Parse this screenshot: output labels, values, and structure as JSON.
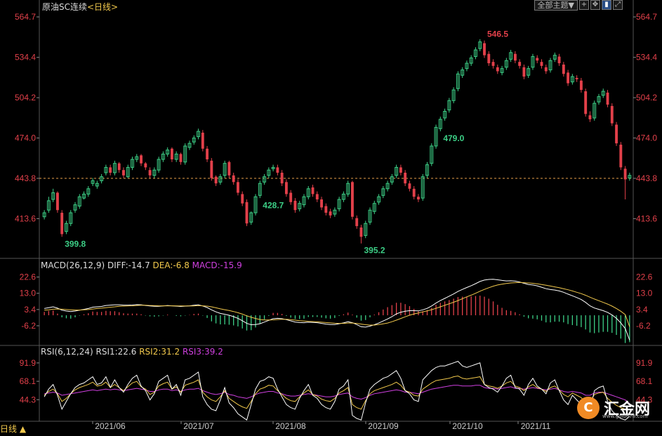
{
  "header": {
    "instrument": "原油SC连续",
    "period_tag": "<日线>",
    "range_button": "全部主题▼",
    "toolbar_icons": [
      "crosshair-icon",
      "move-icon",
      "chart-type-icon",
      "zoom-icon"
    ]
  },
  "macd": {
    "label": "MACD(26,12,9)",
    "diff": "DIFF:-14.7",
    "dea": "DEA:-6.8",
    "macd": "MACD:-15.9"
  },
  "rsi": {
    "label": "RSI(6,12,24)",
    "rsi1": "RSI1:22.6",
    "rsi2": "RSI2:31.2",
    "rsi3": "RSI3:39.2"
  },
  "footer": {
    "period_label": "日线 ▲"
  },
  "logo": {
    "text": "汇金网",
    "url": "www.gold678.com"
  },
  "colors": {
    "up": "#3ccf86",
    "down": "#e2404a",
    "axis_text": "#e2404a",
    "dashed_line": "#e8a04a",
    "macd_dea": "#f2c94c",
    "rsi3": "#d040e0"
  },
  "chart_data": {
    "type": "candlestick",
    "price_ticks": [
      564.7,
      534.4,
      504.2,
      474.0,
      443.8,
      413.6
    ],
    "price_ylim": [
      387,
      570
    ],
    "last_price_line": 443.8,
    "annotations": [
      {
        "label": "399.8",
        "value": 399.8
      },
      {
        "label": "479.0",
        "value": 479.0
      },
      {
        "label": "395.2",
        "value": 395.2
      },
      {
        "label": "546.5",
        "value": 546.5
      },
      {
        "label": "428.7",
        "value": 428.7
      }
    ],
    "x_labels": [
      "2021/06",
      "2021/07",
      "2021/08",
      "2021/09",
      "2021/10",
      "2021/11"
    ],
    "closes": [
      418,
      427,
      433,
      420,
      402,
      410,
      418,
      424,
      430,
      432,
      436,
      442,
      440,
      445,
      452,
      448,
      455,
      450,
      446,
      452,
      458,
      460,
      455,
      452,
      446,
      450,
      458,
      462,
      465,
      458,
      462,
      456,
      468,
      470,
      474,
      479,
      466,
      458,
      444,
      440,
      445,
      455,
      446,
      441,
      433,
      425,
      410,
      418,
      430,
      440,
      445,
      450,
      452,
      448,
      440,
      432,
      426,
      420,
      425,
      430,
      436,
      432,
      428,
      422,
      418,
      416,
      420,
      428,
      432,
      440,
      415,
      408,
      400,
      410,
      420,
      425,
      430,
      436,
      440,
      445,
      452,
      448,
      440,
      436,
      430,
      428,
      445,
      454,
      468,
      482,
      488,
      494,
      502,
      510,
      522,
      525,
      530,
      534,
      540,
      546,
      536,
      530,
      528,
      524,
      526,
      532,
      538,
      532,
      528,
      520,
      526,
      535,
      532,
      528,
      524,
      532,
      536,
      530,
      522,
      515,
      520,
      518,
      510,
      492,
      488,
      500,
      505,
      509,
      499,
      485,
      470,
      452,
      443,
      446
    ],
    "opens": [
      415,
      420,
      428,
      433,
      418,
      404,
      410,
      420,
      423,
      429,
      432,
      440,
      438,
      442,
      448,
      452,
      448,
      455,
      450,
      445,
      452,
      458,
      461,
      455,
      450,
      446,
      450,
      458,
      462,
      466,
      458,
      462,
      456,
      467,
      471,
      475,
      478,
      466,
      457,
      445,
      441,
      446,
      456,
      446,
      441,
      432,
      426,
      411,
      418,
      431,
      441,
      446,
      451,
      452,
      448,
      441,
      433,
      427,
      421,
      424,
      430,
      437,
      432,
      428,
      423,
      419,
      417,
      421,
      428,
      432,
      441,
      414,
      407,
      401,
      411,
      419,
      426,
      431,
      436,
      441,
      446,
      452,
      448,
      440,
      436,
      430,
      429,
      446,
      455,
      468,
      481,
      489,
      495,
      502,
      511,
      521,
      526,
      530,
      535,
      541,
      545,
      537,
      531,
      527,
      523,
      527,
      533,
      537,
      531,
      527,
      521,
      527,
      534,
      531,
      527,
      525,
      533,
      535,
      529,
      523,
      516,
      519,
      517,
      509,
      491,
      489,
      501,
      506,
      508,
      498,
      484,
      469,
      451,
      444
    ],
    "highs": [
      420,
      430,
      436,
      434,
      420,
      412,
      420,
      426,
      432,
      434,
      438,
      444,
      442,
      447,
      454,
      454,
      457,
      456,
      452,
      454,
      460,
      462,
      462,
      456,
      452,
      452,
      460,
      464,
      467,
      467,
      464,
      463,
      470,
      472,
      476,
      481,
      480,
      468,
      459,
      446,
      447,
      457,
      457,
      448,
      443,
      434,
      428,
      419,
      432,
      442,
      447,
      452,
      454,
      454,
      450,
      443,
      435,
      429,
      427,
      432,
      438,
      439,
      434,
      430,
      425,
      421,
      422,
      430,
      434,
      442,
      442,
      416,
      409,
      412,
      422,
      427,
      432,
      438,
      442,
      447,
      454,
      454,
      450,
      442,
      438,
      432,
      447,
      456,
      470,
      484,
      490,
      496,
      504,
      512,
      524,
      527,
      532,
      536,
      542,
      548,
      547,
      539,
      533,
      529,
      528,
      534,
      540,
      539,
      533,
      529,
      528,
      537,
      536,
      533,
      529,
      534,
      538,
      537,
      531,
      525,
      522,
      521,
      519,
      511,
      494,
      502,
      507,
      511,
      510,
      500,
      486,
      471,
      453,
      448
    ],
    "lows": [
      413,
      418,
      426,
      418,
      400,
      402,
      408,
      418,
      421,
      428,
      430,
      438,
      436,
      440,
      446,
      446,
      446,
      448,
      444,
      444,
      450,
      456,
      453,
      450,
      444,
      444,
      448,
      456,
      460,
      456,
      456,
      454,
      454,
      465,
      469,
      473,
      464,
      456,
      442,
      438,
      439,
      444,
      444,
      439,
      431,
      423,
      408,
      409,
      416,
      429,
      439,
      444,
      449,
      446,
      438,
      430,
      424,
      418,
      419,
      422,
      428,
      430,
      426,
      420,
      416,
      414,
      415,
      419,
      426,
      430,
      413,
      406,
      395,
      399,
      409,
      417,
      424,
      429,
      434,
      439,
      444,
      446,
      438,
      434,
      428,
      426,
      427,
      444,
      453,
      466,
      479,
      487,
      493,
      500,
      509,
      519,
      524,
      528,
      533,
      539,
      534,
      528,
      526,
      522,
      521,
      525,
      531,
      530,
      526,
      518,
      519,
      525,
      530,
      526,
      522,
      523,
      531,
      528,
      520,
      513,
      514,
      516,
      508,
      490,
      486,
      487,
      499,
      504,
      497,
      483,
      468,
      450,
      428,
      442
    ],
    "macd_ticks": [
      22.6,
      13.0,
      3.4,
      -6.2
    ],
    "macd_ylim": [
      -17,
      27
    ],
    "diff": [
      4,
      4.5,
      5,
      4.2,
      3,
      2.5,
      2.2,
      2.5,
      3,
      3.5,
      4,
      4.8,
      5,
      5.2,
      5.8,
      6,
      6.2,
      6.2,
      6,
      6,
      6.1,
      6.3,
      6.2,
      5.8,
      5.5,
      5.3,
      5.3,
      5.5,
      5.8,
      5.6,
      5.4,
      5.2,
      5.4,
      5.6,
      5.9,
      6.2,
      5.5,
      4.6,
      3.2,
      2,
      1.1,
      0.6,
      0,
      -0.8,
      -1.8,
      -3.2,
      -4.8,
      -5.6,
      -5.5,
      -5,
      -4,
      -3,
      -2,
      -1.8,
      -2,
      -2.6,
      -3.3,
      -4,
      -4.3,
      -4.4,
      -4.1,
      -4.2,
      -4.4,
      -4.8,
      -5.2,
      -5.5,
      -5.5,
      -5,
      -4.5,
      -3.8,
      -4.4,
      -5.5,
      -6.8,
      -7,
      -6.4,
      -5.6,
      -4.6,
      -3.4,
      -2.2,
      -0.8,
      0.8,
      1.8,
      2.4,
      2.7,
      2.7,
      2.6,
      3.2,
      4.1,
      5.5,
      7.2,
      8.7,
      10,
      11.3,
      12.6,
      14.1,
      15.3,
      16.4,
      17.5,
      18.7,
      20,
      20.8,
      21.2,
      21.3,
      21,
      20.6,
      20.3,
      20.4,
      20.2,
      19.7,
      18.9,
      18.2,
      17.9,
      17.4,
      16.6,
      15.7,
      15.2,
      14.9,
      14.4,
      13.6,
      12.5,
      11.5,
      10.5,
      9.3,
      7.6,
      5.6,
      4.3,
      3.5,
      2.7,
      1.7,
      0.2,
      -1.8,
      -4.5,
      -7.8,
      -14.7
    ],
    "dea": [
      3,
      3.2,
      3.6,
      3.7,
      3.6,
      3.4,
      3.2,
      3.1,
      3.1,
      3.2,
      3.4,
      3.7,
      4,
      4.2,
      4.5,
      4.8,
      5,
      5.3,
      5.4,
      5.5,
      5.6,
      5.8,
      5.9,
      5.9,
      5.8,
      5.7,
      5.6,
      5.6,
      5.6,
      5.6,
      5.6,
      5.5,
      5.5,
      5.5,
      5.5,
      5.7,
      5.6,
      5.4,
      5,
      4.4,
      3.8,
      3.3,
      2.8,
      2.2,
      1.5,
      0.7,
      -0.3,
      -1.2,
      -1.9,
      -2.5,
      -2.8,
      -2.8,
      -2.7,
      -2.5,
      -2.4,
      -2.4,
      -2.6,
      -2.9,
      -3.2,
      -3.4,
      -3.6,
      -3.7,
      -3.9,
      -4.1,
      -4.3,
      -4.5,
      -4.7,
      -4.8,
      -4.8,
      -4.6,
      -4.6,
      -4.8,
      -5.2,
      -5.6,
      -5.8,
      -5.8,
      -5.5,
      -5.1,
      -4.6,
      -3.8,
      -2.9,
      -1.9,
      -0.9,
      0,
      0.8,
      1.4,
      2,
      2.6,
      3.3,
      4.1,
      5,
      5.9,
      6.8,
      7.7,
      8.7,
      9.8,
      10.9,
      11.9,
      13,
      14.2,
      15.3,
      16.3,
      17.2,
      17.9,
      18.4,
      18.8,
      19.1,
      19.3,
      19.4,
      19.3,
      19.1,
      18.9,
      18.6,
      18.2,
      17.8,
      17.3,
      16.8,
      16.3,
      15.7,
      15.1,
      14.4,
      13.6,
      12.8,
      11.8,
      10.7,
      9.6,
      8.6,
      7.6,
      6.6,
      5.4,
      4,
      2.4,
      0.4,
      -6.8
    ],
    "macd_hist": [
      2,
      2.6,
      2.8,
      1,
      -1.2,
      -1.8,
      -2,
      -1.2,
      -0.2,
      0.6,
      1.2,
      2.2,
      2,
      2,
      2.6,
      2.4,
      2.4,
      1.8,
      1.2,
      1,
      1,
      1,
      0.6,
      -0.2,
      -0.6,
      -0.8,
      -0.6,
      -0.2,
      0.4,
      0,
      -0.4,
      -0.6,
      -0.2,
      0.2,
      0.8,
      1,
      -0.2,
      -1.6,
      -3.6,
      -4.8,
      -5.4,
      -5.4,
      -5.6,
      -6,
      -6.6,
      -7.8,
      -9,
      -8.8,
      -7.2,
      -5,
      -2.4,
      -0.4,
      1.4,
      1.4,
      0.8,
      -0.4,
      -1.4,
      -2.2,
      -2.2,
      -2,
      -1,
      -1,
      -1,
      -1.4,
      -1.8,
      -2,
      -1.6,
      -0.4,
      0.6,
      1.6,
      0.4,
      -1.4,
      -3.2,
      -2.8,
      -1.2,
      0.4,
      1.8,
      3.4,
      4.8,
      6,
      7.4,
      7.4,
      6.6,
      5.4,
      3.8,
      2.4,
      2.4,
      3,
      4.4,
      6.2,
      7.4,
      8.2,
      9,
      9.8,
      10.8,
      11,
      11,
      11.2,
      11.4,
      11.6,
      11,
      9.8,
      8.2,
      6.2,
      4.4,
      3,
      2.6,
      1.8,
      0.6,
      -0.8,
      -1.8,
      -2,
      -2.4,
      -3.2,
      -4.2,
      -4.2,
      -3.8,
      -3.8,
      -4.2,
      -5.2,
      -5.8,
      -6.2,
      -7,
      -8.4,
      -10.2,
      -10.6,
      -10.2,
      -9.8,
      -9.8,
      -10.4,
      -11.6,
      -13.8,
      -16.4,
      -15.9
    ],
    "rsi_ticks": [
      91.9,
      68.1,
      44.3
    ],
    "rsi_ylim": [
      20,
      100
    ],
    "rsi1": [
      48,
      58,
      64,
      50,
      32,
      42,
      52,
      60,
      64,
      66,
      70,
      74,
      64,
      66,
      74,
      60,
      70,
      60,
      54,
      64,
      72,
      76,
      62,
      56,
      44,
      52,
      68,
      72,
      76,
      58,
      64,
      50,
      70,
      72,
      76,
      80,
      48,
      38,
      32,
      30,
      44,
      60,
      40,
      34,
      26,
      22,
      18,
      38,
      58,
      68,
      70,
      74,
      72,
      58,
      48,
      38,
      34,
      32,
      46,
      56,
      64,
      50,
      46,
      38,
      34,
      32,
      42,
      58,
      62,
      70,
      24,
      20,
      18,
      40,
      58,
      64,
      68,
      72,
      74,
      78,
      82,
      72,
      56,
      52,
      44,
      42,
      70,
      76,
      82,
      86,
      88,
      88,
      90,
      92,
      94,
      88,
      86,
      88,
      90,
      92,
      64,
      60,
      58,
      54,
      62,
      72,
      76,
      60,
      58,
      50,
      64,
      72,
      62,
      58,
      52,
      66,
      70,
      56,
      44,
      38,
      50,
      44,
      38,
      24,
      30,
      56,
      60,
      62,
      42,
      30,
      24,
      20,
      18,
      22.6
    ],
    "rsi2": [
      50,
      55,
      58,
      52,
      42,
      46,
      52,
      57,
      60,
      62,
      64,
      67,
      62,
      63,
      67,
      60,
      64,
      60,
      56,
      61,
      66,
      68,
      61,
      58,
      51,
      54,
      62,
      65,
      67,
      58,
      61,
      54,
      63,
      65,
      67,
      70,
      54,
      48,
      44,
      42,
      48,
      56,
      46,
      42,
      38,
      35,
      33,
      42,
      52,
      58,
      60,
      63,
      62,
      56,
      51,
      46,
      43,
      42,
      48,
      53,
      57,
      51,
      49,
      45,
      43,
      42,
      46,
      53,
      56,
      60,
      38,
      34,
      32,
      43,
      52,
      56,
      58,
      60,
      62,
      64,
      67,
      63,
      56,
      54,
      50,
      49,
      58,
      62,
      66,
      69,
      70,
      71,
      72,
      74,
      75,
      72,
      71,
      72,
      73,
      74,
      64,
      62,
      61,
      59,
      62,
      66,
      68,
      62,
      60,
      56,
      61,
      64,
      60,
      58,
      55,
      60,
      62,
      57,
      51,
      48,
      53,
      50,
      47,
      40,
      41,
      51,
      53,
      54,
      46,
      41,
      37,
      34,
      32,
      31.2
    ],
    "rsi3": [
      52,
      53,
      54,
      53,
      50,
      51,
      52,
      53,
      54,
      55,
      56,
      57,
      56,
      57,
      58,
      57,
      58,
      57,
      56,
      57,
      58,
      59,
      58,
      57,
      55,
      55,
      57,
      58,
      58,
      56,
      57,
      55,
      57,
      58,
      58,
      59,
      56,
      54,
      52,
      51,
      52,
      54,
      51,
      50,
      48,
      47,
      46,
      48,
      51,
      53,
      54,
      55,
      55,
      53,
      52,
      50,
      49,
      49,
      50,
      51,
      52,
      51,
      50,
      49,
      48,
      48,
      49,
      51,
      52,
      53,
      48,
      46,
      45,
      47,
      50,
      52,
      53,
      54,
      55,
      56,
      57,
      56,
      54,
      54,
      53,
      52,
      54,
      56,
      58,
      59,
      60,
      61,
      62,
      63,
      63,
      62,
      62,
      62,
      63,
      63,
      60,
      59,
      59,
      58,
      59,
      60,
      61,
      59,
      59,
      58,
      59,
      60,
      59,
      58,
      57,
      58,
      59,
      57,
      55,
      54,
      55,
      54,
      53,
      50,
      50,
      53,
      54,
      54,
      52,
      50,
      48,
      46,
      44,
      39.2
    ]
  }
}
